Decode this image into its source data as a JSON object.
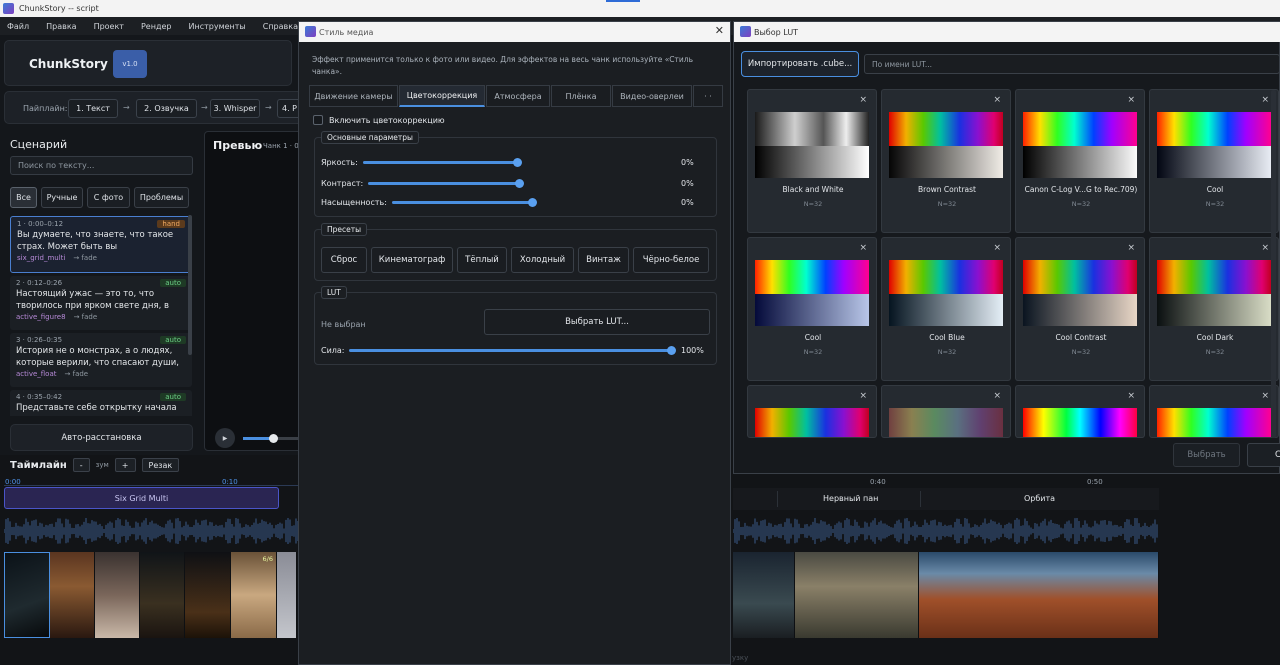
{
  "window": {
    "title": "ChunkStory -- script"
  },
  "menu": [
    "Файл",
    "Правка",
    "Проект",
    "Рендер",
    "Инструменты",
    "Справка"
  ],
  "brand": {
    "name": "ChunkStory",
    "version": "v1.0"
  },
  "pipeline": {
    "label": "Пайплайн:",
    "steps": [
      "1. Текст",
      "2. Озвучка",
      "3. Whisper",
      "4. Р"
    ]
  },
  "scenario": {
    "title": "Сценарий",
    "search_placeholder": "Поиск по тексту...",
    "filters": [
      "Все",
      "Ручные",
      "С фото",
      "Проблемы"
    ],
    "items": [
      {
        "head": "1 · 0:00–0:12",
        "tag": "hand",
        "text": "Вы думаете, что знаете, что такое страх. Может быть вы",
        "style": "six_grid_multi",
        "trans": "→ fade"
      },
      {
        "head": "2 · 0:12–0:26",
        "tag": "auto",
        "text": "Настоящий ужас — это то, что творилось при ярком свете дня, в",
        "style": "active_figure8",
        "trans": "→ fade"
      },
      {
        "head": "3 · 0:26–0:35",
        "tag": "auto",
        "text": "История не о монстрах, а о людях, которые верили, что спасают души,",
        "style": "active_float",
        "trans": "→ fade"
      },
      {
        "head": "4 · 0:35–0:42",
        "tag": "auto",
        "text": "Представьте себе открытку начала",
        "style": "",
        "trans": ""
      }
    ],
    "auto_button": "Авто-расстановка"
  },
  "preview": {
    "title": "Превью",
    "chunk": "Чанк 1 · 0",
    "play": "▶"
  },
  "timeline": {
    "title": "Таймлайн",
    "minus": "-",
    "zoom": "зум",
    "plus": "+",
    "cut": "Резак",
    "ticks": [
      "0:00",
      "0:10",
      "0:40",
      "0:50"
    ],
    "segment": "Six Grid Multi",
    "right_segments": [
      "Нервный пан",
      "Орбита"
    ],
    "badge": "6/6",
    "footer_hint": "узку"
  },
  "media_style": {
    "title": "Стиль медиа",
    "close": "✕",
    "note": "Эффект применится только к фото или видео. Для эффектов на весь чанк используйте «Стиль чанка».",
    "tabs": [
      "Движение камеры",
      "Цветокоррекция",
      "Атмосфера",
      "Плёнка",
      "Видео-оверлеи",
      "· ·"
    ],
    "enable_label": "Включить цветокоррекцию",
    "basic": {
      "title": "Основные параметры",
      "rows": [
        {
          "label": "Яркость:",
          "value": "0%"
        },
        {
          "label": "Контраст:",
          "value": "0%"
        },
        {
          "label": "Насыщенность:",
          "value": "0%"
        }
      ]
    },
    "presets": {
      "title": "Пресеты",
      "items": [
        "Сброс",
        "Кинематограф",
        "Тёплый",
        "Холодный",
        "Винтаж",
        "Чёрно-белое"
      ]
    },
    "lut": {
      "title": "LUT",
      "current": "Не выбран",
      "choose_btn": "Выбрать LUT...",
      "strength_label": "Сила:",
      "strength_value": "100%"
    }
  },
  "lut_picker": {
    "title": "Выбор LUT",
    "import_btn": "Импортировать .cube...",
    "search_placeholder": "По имени LUT...",
    "close_glyph": "×",
    "luts": [
      {
        "name": "Black and White",
        "n": "N=32",
        "top": "bw",
        "bottom": "bwb"
      },
      {
        "name": "Brown Contrast",
        "n": "N=32",
        "top": "rb",
        "bottom": "brown"
      },
      {
        "name": "Canon C-Log V...G to Rec.709)",
        "n": "N=32",
        "top": "rb2",
        "bottom": "gray"
      },
      {
        "name": "Cool",
        "n": "N=32",
        "top": "rb2",
        "bottom": "cool"
      },
      {
        "name": "Cool",
        "n": "N=32",
        "top": "rb2",
        "bottom": "coolblue"
      },
      {
        "name": "Cool Blue",
        "n": "N=32",
        "top": "rb",
        "bottom": "coolb2"
      },
      {
        "name": "Cool Contrast",
        "n": "N=32",
        "top": "rb",
        "bottom": "coolcon"
      },
      {
        "name": "Cool Dark",
        "n": "N=32",
        "top": "rb",
        "bottom": "cooldark"
      },
      {
        "name": "",
        "n": "",
        "top": "rb",
        "bottom": ""
      },
      {
        "name": "",
        "n": "",
        "top": "muted",
        "bottom": ""
      },
      {
        "name": "",
        "n": "",
        "top": "rb3",
        "bottom": ""
      },
      {
        "name": "",
        "n": "",
        "top": "rb2",
        "bottom": ""
      }
    ],
    "choose_btn": "Выбрать",
    "cancel_btn": "Са"
  },
  "colors": {
    "accent": "#4a8fe0",
    "segment": "#2a2552",
    "hand_tag": "#f0a860",
    "auto_tag": "#6ccf86"
  }
}
